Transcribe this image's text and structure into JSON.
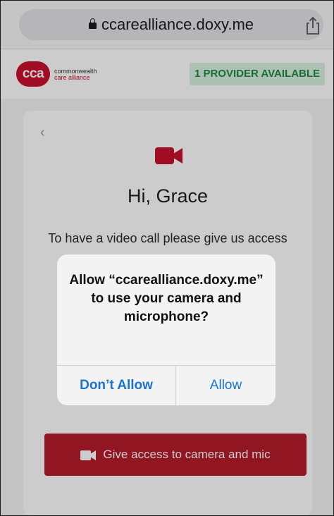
{
  "browser": {
    "url": "ccarealliance.doxy.me"
  },
  "header": {
    "logo_mark": "cca",
    "logo_line1": "commonwealth",
    "logo_line2": "care alliance",
    "provider_badge": "1 PROVIDER AVAILABLE"
  },
  "main": {
    "back_label": "‹",
    "greeting": "Hi, Grace",
    "instruction": "To have a video call please give us access",
    "give_access_button": "Give access to camera and mic"
  },
  "dialog": {
    "message": "Allow “ccarealliance.doxy.me” to use your camera and microphone?",
    "dont_allow": "Don’t Allow",
    "allow": "Allow"
  },
  "colors": {
    "brand_red": "#b71c2a",
    "badge_green": "#1f8a43",
    "ios_blue": "#1a73d1"
  },
  "icons": [
    "lock-icon",
    "share-icon",
    "back-chevron-icon",
    "video-camera-icon"
  ]
}
